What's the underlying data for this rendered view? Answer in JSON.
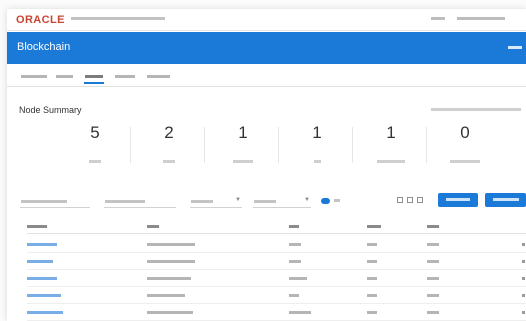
{
  "header": {
    "logo": "ORACLE",
    "product_name": "",
    "top_right": [
      "",
      ""
    ]
  },
  "app": {
    "title": "Blockchain",
    "menu_label": ""
  },
  "tabs": [
    "",
    "",
    "",
    "",
    ""
  ],
  "tabs_active_index": 2,
  "summary": {
    "title": "Node Summary",
    "meta": "",
    "metrics": [
      {
        "value": "5",
        "caption": ""
      },
      {
        "value": "2",
        "caption": ""
      },
      {
        "value": "1",
        "caption": ""
      },
      {
        "value": "1",
        "caption": ""
      },
      {
        "value": "1",
        "caption": ""
      },
      {
        "value": "0",
        "caption": ""
      }
    ]
  },
  "toolbar": {
    "filters": [
      "",
      "",
      "",
      ""
    ],
    "toggle_label": "",
    "primary_button": "",
    "secondary_button": ""
  },
  "table": {
    "columns": [
      "",
      "",
      "",
      "",
      ""
    ],
    "rows": [
      [
        "",
        "",
        "",
        "",
        ""
      ],
      [
        "",
        "",
        "",
        "",
        ""
      ],
      [
        "",
        "",
        "",
        "",
        ""
      ],
      [
        "",
        "",
        "",
        "",
        ""
      ],
      [
        "",
        "",
        "",
        "",
        ""
      ]
    ]
  },
  "colors": {
    "brand_red": "#c74634",
    "accent_blue": "#1b79d8",
    "link_blue": "#79ade6"
  }
}
